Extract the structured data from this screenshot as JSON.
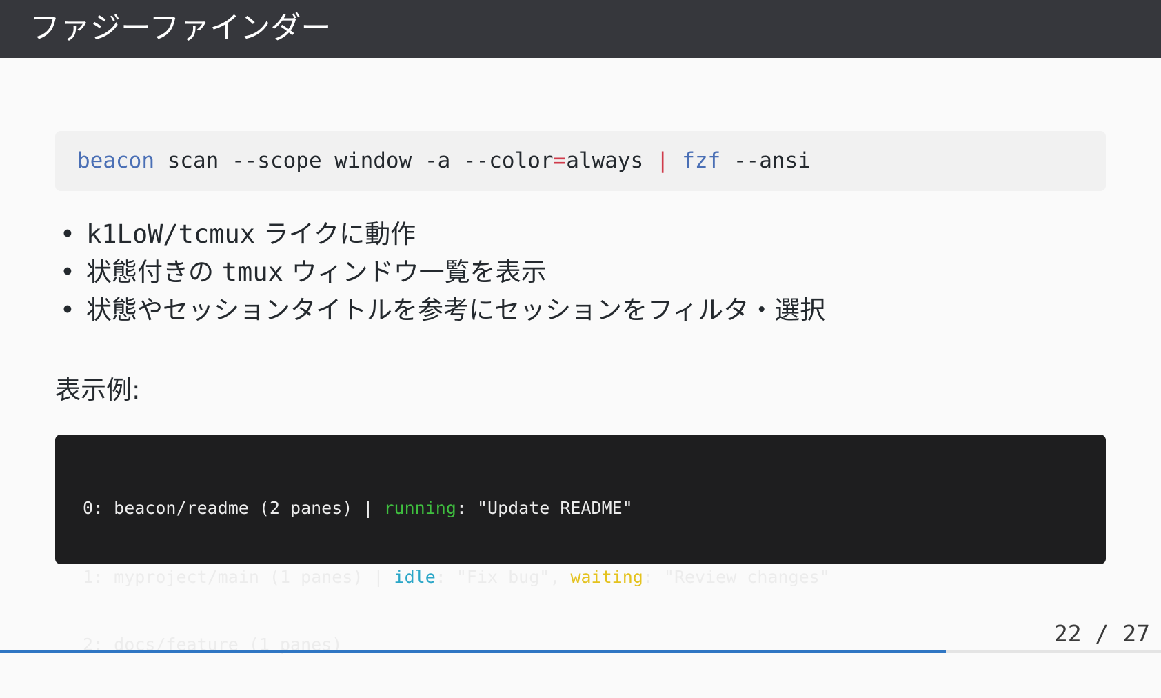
{
  "slide": {
    "title": "ファジーファインダー",
    "command": {
      "program": "beacon",
      "args": " scan --scope window -a --color",
      "equals": "=",
      "value": "always ",
      "pipe": "|",
      "filter": " fzf",
      "filter_args": " --ansi"
    },
    "bullets": [
      {
        "mono": "k1LoW/tcmux",
        "text": " ライクに動作"
      },
      {
        "prefix": "状態付きの ",
        "mono": "tmux",
        "text": " ウィンドウ一覧を表示"
      },
      {
        "text": "状態やセッションタイトルを参考にセッションをフィルタ・選択"
      }
    ],
    "bullet_marker": "•",
    "example_heading": "表示例:",
    "terminal": {
      "lines": [
        {
          "prefix": "0: beacon/readme (2 panes) | ",
          "status1": "running",
          "mid1": ": \"Update README\""
        },
        {
          "prefix": "1: myproject/main (1 panes) | ",
          "status1": "idle",
          "mid1": ": \"Fix bug\", ",
          "status2": "waiting",
          "mid2": ": \"Review changes\""
        },
        {
          "prefix": "2: docs/feature (1 panes)"
        }
      ]
    },
    "page_number": "22 / 27",
    "progress": {
      "current": 22,
      "total": 27
    }
  },
  "colors": {
    "title_bar": "#36373c",
    "keyword_blue": "#4a6fb5",
    "operator_red": "#d03b4b",
    "status_running": "#3fbf3f",
    "status_idle": "#2aa6c7",
    "status_waiting": "#e4c21e",
    "progress": "#2f76c3"
  }
}
